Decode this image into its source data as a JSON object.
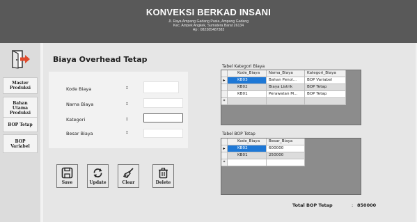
{
  "header": {
    "title": "KONVEKSI BERKAD INSANI",
    "address_line1": "Jl. Raya Ampang Gadang Pasia, Ampang Gadang",
    "address_line2": "Kec. Ampek Angkek, Sumatera Barat 26134",
    "phone": "Hp : 082385487383"
  },
  "sidebar": {
    "exit_icon": "exit-door-icon",
    "items": [
      {
        "label": "Master Produksi"
      },
      {
        "label": "Bahan Utama Produksi"
      },
      {
        "label": "BOP Tetap"
      },
      {
        "label": "BOP Variabel"
      }
    ]
  },
  "page": {
    "title": "Biaya Overhead Tetap"
  },
  "form": {
    "kode_label": "Kode Biaya",
    "nama_label": "Nama Biaya",
    "kategori_label": "Kategori",
    "besar_label": "Besar Biaya",
    "colon": ":",
    "kode_value": "",
    "nama_value": "",
    "kategori_value": "",
    "besar_value": ""
  },
  "actions": {
    "save": {
      "label": "Save",
      "icon": "save-icon"
    },
    "update": {
      "label": "Update",
      "icon": "refresh-icon"
    },
    "clear": {
      "label": "Clear",
      "icon": "broom-icon"
    },
    "delete": {
      "label": "Delete",
      "icon": "trash-icon"
    }
  },
  "kategori_table": {
    "caption": "Tabel Kategori Biaya",
    "columns": [
      "Kode_Biaya",
      "Nama_Biaya",
      "Kategori_Biaya"
    ],
    "rows": [
      [
        "KB03",
        "Bahan Penol...",
        "BOP Variabel"
      ],
      [
        "KB02",
        "Biaya Listrik",
        "BOP Tetap"
      ],
      [
        "KB01",
        "Perawatan M...",
        "BOP Tetap"
      ]
    ],
    "current_marker": "▸",
    "new_marker": "*"
  },
  "bop_table": {
    "caption": "Tabel BOP Tetap",
    "columns": [
      "Kode_Biaya",
      "Besar_Biaya"
    ],
    "rows": [
      [
        "KB02",
        "600000"
      ],
      [
        "KB01",
        "250000"
      ]
    ],
    "current_marker": "▸",
    "new_marker": "*"
  },
  "total": {
    "label": "Total BOP Tetap",
    "colon": ":",
    "value": "850000"
  },
  "colors": {
    "header_bg": "#595959",
    "selection": "#1e78d6",
    "grid_bg": "#8c8c8c"
  }
}
